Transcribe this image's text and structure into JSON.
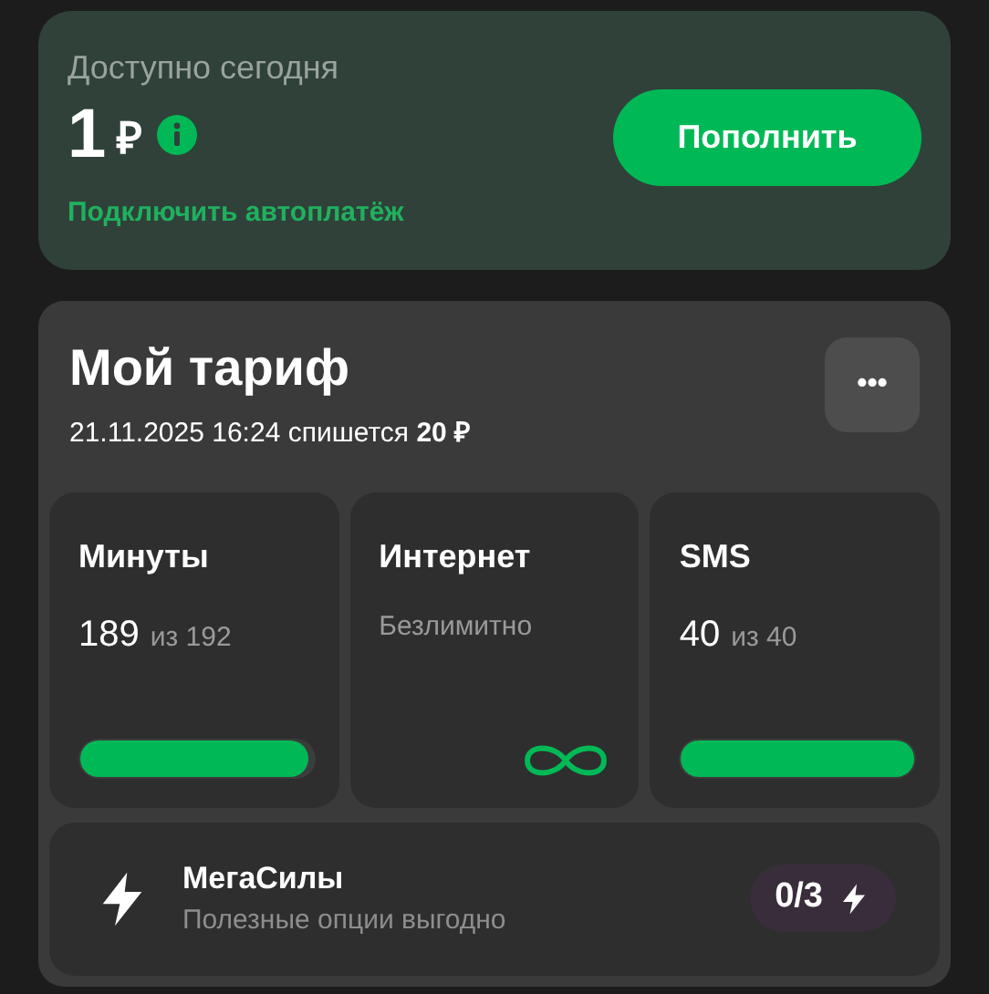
{
  "balance": {
    "label": "Доступно сегодня",
    "amount": "1",
    "currency": "₽",
    "topup_button": "Пополнить",
    "autopay_link": "Подключить автоплатёж"
  },
  "tariff": {
    "title": "Мой тариф",
    "more_button": "•••",
    "charge_note": "21.11.2025 16:24 спишется **20 ₽**",
    "tiles": [
      {
        "kind": "meter",
        "title": "Минуты",
        "value": "189",
        "total": "из 192",
        "level": 0.98
      },
      {
        "kind": "unlimited",
        "title": "Интернет",
        "value": "Безлимитно"
      },
      {
        "kind": "meter",
        "title": "SMS",
        "value": "40",
        "total": "из 40",
        "level": 1
      }
    ],
    "megasily": {
      "title": "МегаСилы",
      "subtitle": "Полезные опции выгодно",
      "counter": "0/3"
    }
  }
}
